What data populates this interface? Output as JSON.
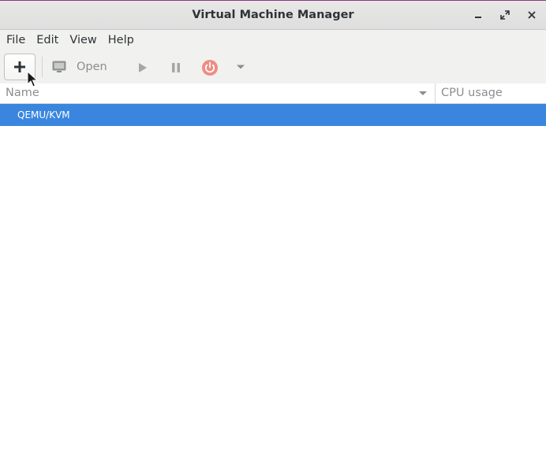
{
  "window": {
    "title": "Virtual Machine Manager"
  },
  "menubar": {
    "items": [
      "File",
      "Edit",
      "View",
      "Help"
    ]
  },
  "toolbar": {
    "new_icon": "plus-icon",
    "open_label": "Open",
    "open_icon": "monitor-icon",
    "run_icon": "play-icon",
    "pause_icon": "pause-icon",
    "shutdown_icon": "power-icon",
    "shutdown_menu_icon": "chevron-down-icon",
    "shutdown_color": "#ef6b5f"
  },
  "list": {
    "columns": {
      "name": "Name",
      "cpu": "CPU usage"
    },
    "rows": [
      {
        "name": "QEMU/KVM",
        "selected": true
      }
    ],
    "selection_color": "#3a86df"
  }
}
